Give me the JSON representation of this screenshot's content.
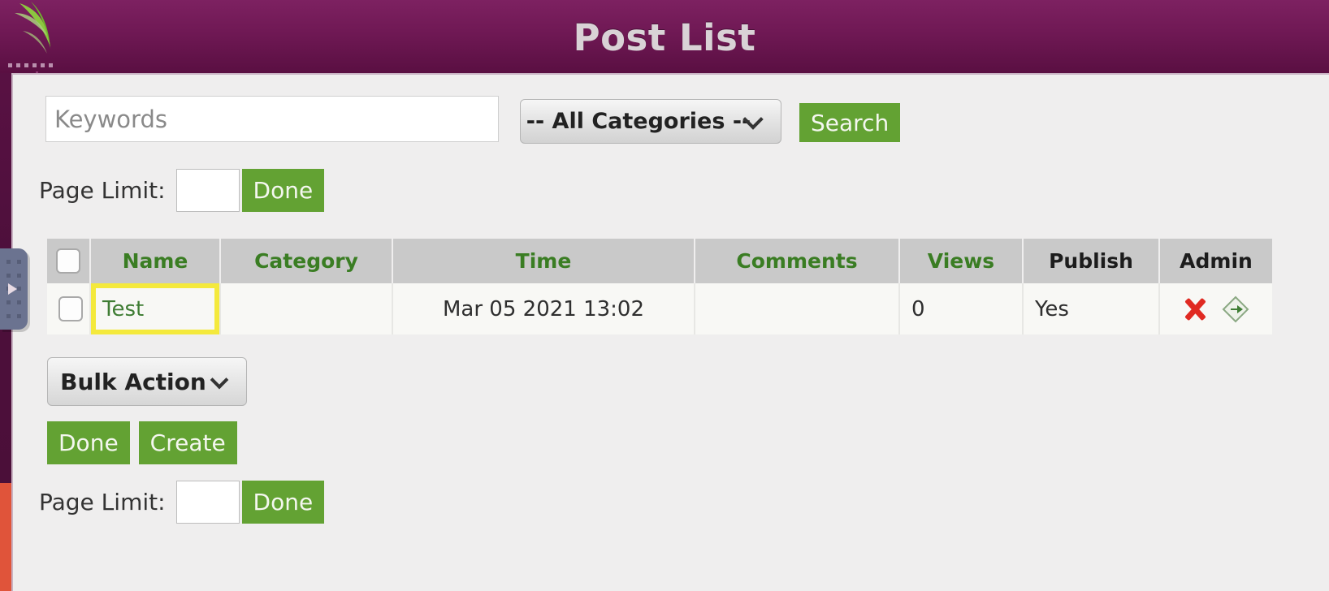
{
  "window": {
    "title": "Post List",
    "logo_icon": "leaf-logo-icon",
    "header_dots_icon": "window-dots-icon"
  },
  "desktop": {
    "dock_handle_icon": "dock-handle-arrow-icon",
    "colors": {
      "header_purple": "#701955",
      "edge_purple": "#4d0f3b",
      "edge_red": "#e0543a",
      "accent_green": "#63a233",
      "link_green": "#3f7d34",
      "highlight_yellow": "#f4e93c",
      "delete_red": "#e02a22"
    }
  },
  "search": {
    "keywords_placeholder": "Keywords",
    "keywords_value": "",
    "category_selected": "-- All Categories --",
    "category_options": [
      "-- All Categories --"
    ],
    "category_chevron_icon": "chevron-down-icon",
    "search_label": "Search"
  },
  "page_limit_top": {
    "label": "Page Limit:",
    "value": "",
    "done_label": "Done"
  },
  "page_limit_bottom": {
    "label": "Page Limit:",
    "value": "",
    "done_label": "Done"
  },
  "table": {
    "select_all_icon": "checkbox-icon",
    "headers": [
      {
        "label": "Name",
        "sortable": true
      },
      {
        "label": "Category",
        "sortable": true
      },
      {
        "label": "Time",
        "sortable": true
      },
      {
        "label": "Comments",
        "sortable": true
      },
      {
        "label": "Views",
        "sortable": true
      },
      {
        "label": "Publish",
        "sortable": false
      },
      {
        "label": "Admin",
        "sortable": false
      }
    ],
    "rows": [
      {
        "checkbox_icon": "checkbox-icon",
        "name": "Test",
        "category": "",
        "time": "Mar 05 2021 13:02",
        "comments": "",
        "views": "0",
        "publish": "Yes",
        "delete_icon": "delete-x-icon",
        "edit_icon": "edit-tag-icon"
      }
    ]
  },
  "bulk": {
    "selected": "Bulk Action",
    "options": [
      "Bulk Action"
    ],
    "chevron_icon": "chevron-down-icon",
    "done_label": "Done",
    "create_label": "Create"
  }
}
